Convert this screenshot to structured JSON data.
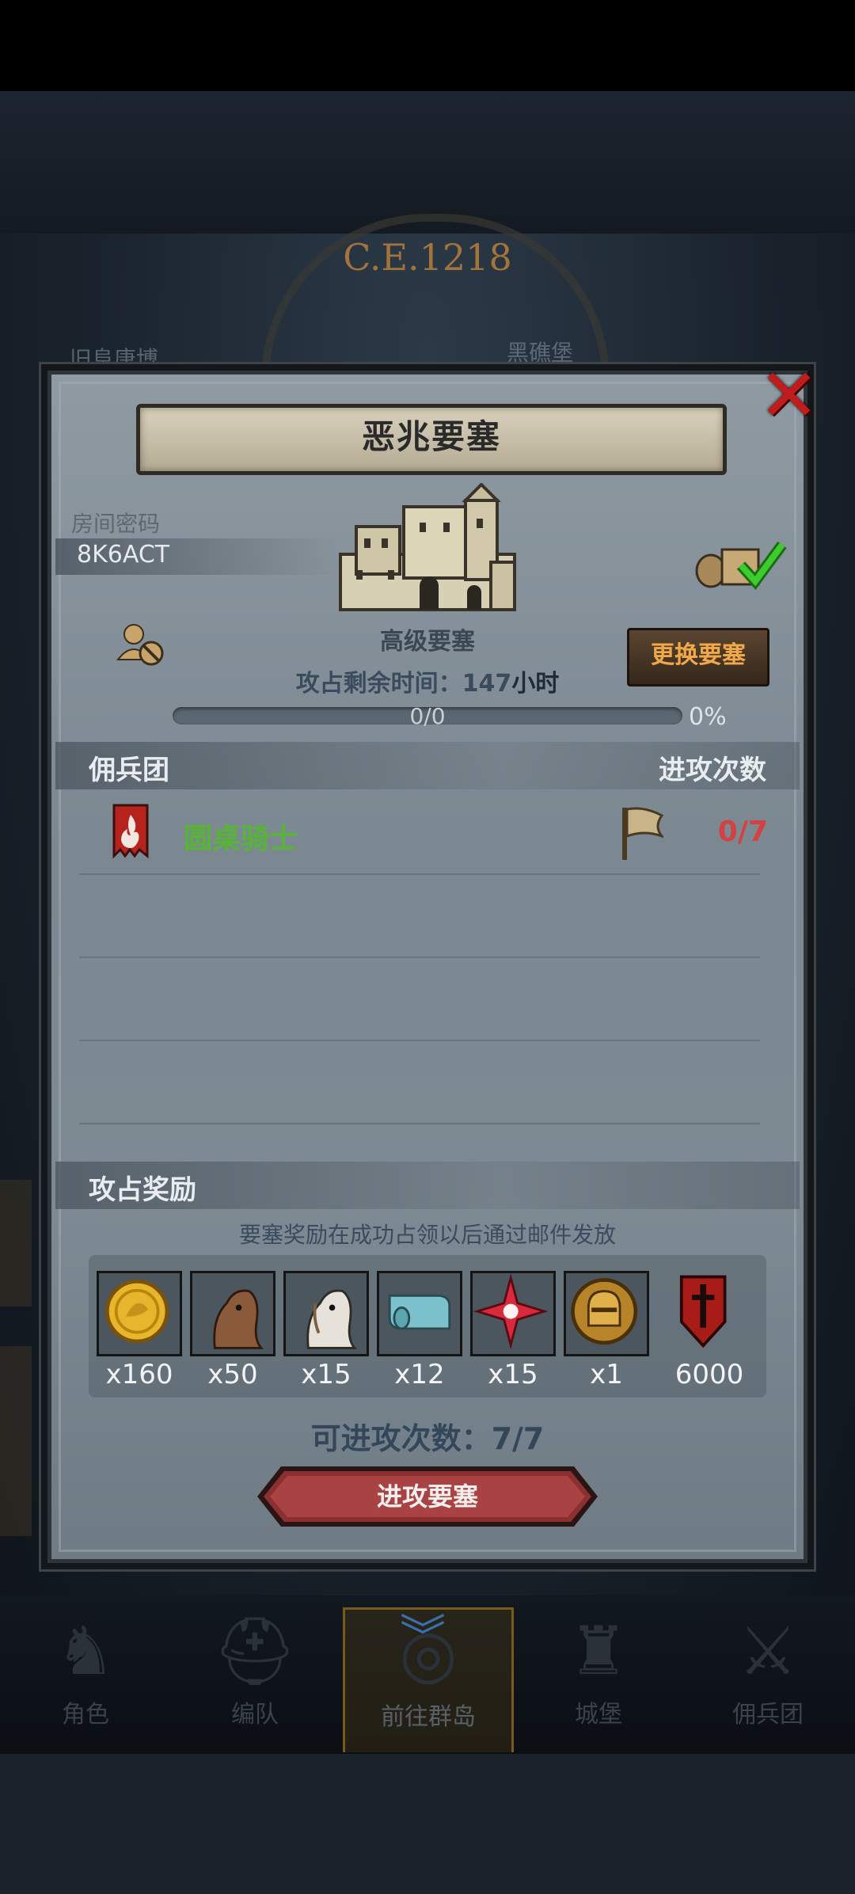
{
  "background": {
    "year": "C.E.1218",
    "map_labels": [
      "旧阜唐博",
      "黑礁堡"
    ]
  },
  "dialog": {
    "title": "恶兆要塞",
    "room_label": "房间密码",
    "room_code": "8K6ACT",
    "fort_type": "高级要塞",
    "swap_button": "更换要塞",
    "remain_prefix": "攻占剩余时间：",
    "remain_value": "147",
    "remain_unit": "小时",
    "progress_text": "0/0",
    "progress_fraction": 0,
    "progress_percent": "0%",
    "merc_section": "佣兵团",
    "attack_count_header": "进攻次数",
    "merc_name": "圆桌骑士",
    "merc_attack_count": "0/7",
    "reward_section": "攻占奖励",
    "reward_note": "要塞奖励在成功占领以后通过邮件发放",
    "rewards": [
      {
        "icon": "gold-coin-icon",
        "qty": "x160"
      },
      {
        "icon": "brown-horse-icon",
        "qty": "x50"
      },
      {
        "icon": "white-horse-icon",
        "qty": "x15"
      },
      {
        "icon": "cloth-roll-icon",
        "qty": "x12"
      },
      {
        "icon": "red-star-gem-icon",
        "qty": "x15"
      },
      {
        "icon": "knight-helmet-coin-icon",
        "qty": "x1"
      },
      {
        "icon": "sword-shield-icon",
        "qty": "6000"
      }
    ],
    "attacks_left": "可进攻次数：7/7",
    "attack_button": "进攻要塞"
  },
  "bottom_nav": [
    {
      "label": "角色",
      "icon": "knight-icon"
    },
    {
      "label": "编队",
      "icon": "helmet-icon"
    },
    {
      "label": "前往群岛",
      "icon": "globe-icon",
      "active": true
    },
    {
      "label": "城堡",
      "icon": "castle-icon"
    },
    {
      "label": "佣兵团",
      "icon": "mercenary-icon"
    }
  ],
  "colors": {
    "merc_name": "#58b436",
    "attack_count": "#d54040",
    "swap_button_text": "#f0a848",
    "close_icon": "#c01c1c"
  }
}
